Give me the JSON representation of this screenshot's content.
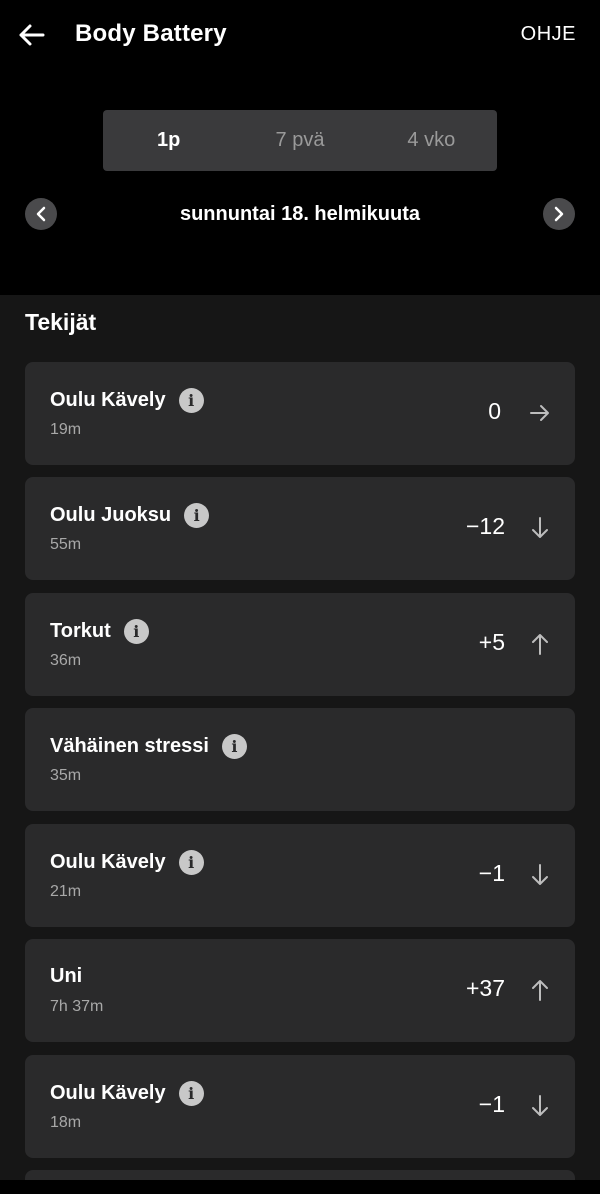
{
  "header": {
    "title": "Body Battery",
    "help_label": "OHJE"
  },
  "tabs": [
    {
      "label": "1p",
      "active": true
    },
    {
      "label": "7 pvä",
      "active": false
    },
    {
      "label": "4 vko",
      "active": false
    }
  ],
  "date_nav": {
    "label": "sunnuntai 18. helmikuuta"
  },
  "section": {
    "title": "Tekijät"
  },
  "items": [
    {
      "name": "Oulu Kävely",
      "duration": "19m",
      "value": "0",
      "trend": "flat",
      "info": true
    },
    {
      "name": "Oulu Juoksu",
      "duration": "55m",
      "value": "−12",
      "trend": "down",
      "info": true
    },
    {
      "name": "Torkut",
      "duration": "36m",
      "value": "+5",
      "trend": "up",
      "info": true
    },
    {
      "name": "Vähäinen stressi",
      "duration": "35m",
      "value": "",
      "trend": "none",
      "info": true
    },
    {
      "name": "Oulu Kävely",
      "duration": "21m",
      "value": "−1",
      "trend": "down",
      "info": true
    },
    {
      "name": "Uni",
      "duration": "7h 37m",
      "value": "+37",
      "trend": "up",
      "info": false
    },
    {
      "name": "Oulu Kävely",
      "duration": "18m",
      "value": "−1",
      "trend": "down",
      "info": true
    }
  ],
  "colors": {
    "background": "#000000",
    "content_bg": "#161616",
    "card_bg": "#2a2a2b",
    "segment_bg": "#3a3a3c",
    "muted_text": "#a8a8a8"
  }
}
